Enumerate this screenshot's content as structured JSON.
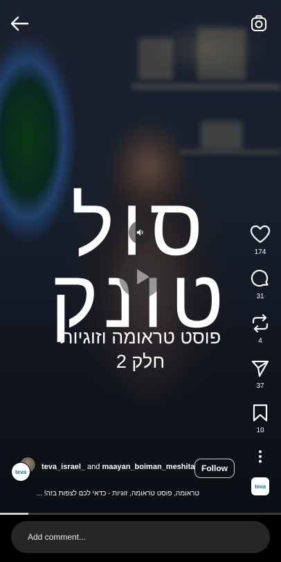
{
  "overlay_text": {
    "title_line1": "סול",
    "title_line2": "טונק",
    "subtitle_line1": "פוסט טראומה וזוגיות",
    "subtitle_line2": "חלק 2"
  },
  "actions": {
    "like_count": "174",
    "comment_count": "31",
    "repost_count": "4",
    "share_count": "37",
    "save_count": "10"
  },
  "author": {
    "brand_avatar_text": "teva",
    "primary_user": "teva_israel_",
    "connector": " and ",
    "collab_user": "maayan_boiman_meshita",
    "follow_label": "Follow"
  },
  "audio_badge_text": "teva",
  "caption": "טראומה, פוסט טראומה, זוגיות - כדאי לכם לצפות בזה! ...",
  "progress": 0.1,
  "comment_placeholder": "Add comment...",
  "icons": [
    "back-arrow-icon",
    "camera-icon",
    "sound-on-icon",
    "play-icon",
    "heart-icon",
    "comment-icon",
    "repost-icon",
    "send-icon",
    "bookmark-icon",
    "more-vertical-icon"
  ]
}
